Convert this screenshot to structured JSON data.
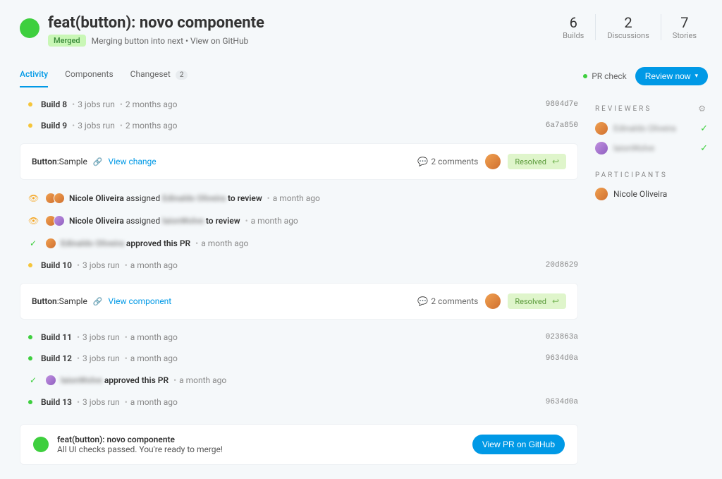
{
  "header": {
    "title": "feat(button): novo componente",
    "status_badge": "Merged",
    "meta": "Merging button into next • View on GitHub"
  },
  "stats": [
    {
      "num": "6",
      "label": "Builds"
    },
    {
      "num": "2",
      "label": "Discussions"
    },
    {
      "num": "7",
      "label": "Stories"
    }
  ],
  "tabs": {
    "activity": "Activity",
    "components": "Components",
    "changeset": "Changeset",
    "changeset_count": "2"
  },
  "pr_check_label": "PR check",
  "review_btn": "Review now",
  "sidebar": {
    "reviewers_h": "REVIEWERS",
    "participants_h": "PARTICIPANTS",
    "reviewers": [
      {
        "name": "Edinaldo Oliveira"
      },
      {
        "name": "laionWolve"
      }
    ],
    "participants": [
      {
        "name": "Nicole Oliveira"
      }
    ]
  },
  "cards": {
    "button_label": "Button",
    "sample_label": ":Sample",
    "view_change": "View change",
    "view_component": "View component",
    "comments_label": "2 comments",
    "resolved": "Resolved"
  },
  "activity": {
    "build8": {
      "label": "Build 8",
      "jobs": "3 jobs run",
      "time": "2 months ago",
      "hash": "9804d7e"
    },
    "build9": {
      "label": "Build 9",
      "jobs": "3 jobs run",
      "time": "2 months ago",
      "hash": "6a7a850"
    },
    "assign1": {
      "actor": "Nicole Oliveira",
      "verb": "assigned",
      "target": "Edinaldo Oliveira",
      "suffix": "to review",
      "time": "a month ago"
    },
    "assign2": {
      "actor": "Nicole Oliveira",
      "verb": "assigned",
      "target": "laionWolve",
      "suffix": "to review",
      "time": "a month ago"
    },
    "approve1": {
      "actor": "Edinaldo Oliveira",
      "verb": "approved this PR",
      "time": "a month ago"
    },
    "build10": {
      "label": "Build 10",
      "jobs": "3 jobs run",
      "time": "a month ago",
      "hash": "20d8629"
    },
    "build11": {
      "label": "Build 11",
      "jobs": "3 jobs run",
      "time": "a month ago",
      "hash": "023863a"
    },
    "build12": {
      "label": "Build 12",
      "jobs": "3 jobs run",
      "time": "a month ago",
      "hash": "9634d0a"
    },
    "approve2": {
      "actor": "laionWolve",
      "verb": "approved this PR",
      "time": "a month ago"
    },
    "build13": {
      "label": "Build 13",
      "jobs": "3 jobs run",
      "time": "a month ago",
      "hash": "9634d0a"
    }
  },
  "footer": {
    "title": "feat(button): novo componente",
    "sub": "All UI checks passed. You're ready to merge!",
    "btn": "View PR on GitHub"
  }
}
